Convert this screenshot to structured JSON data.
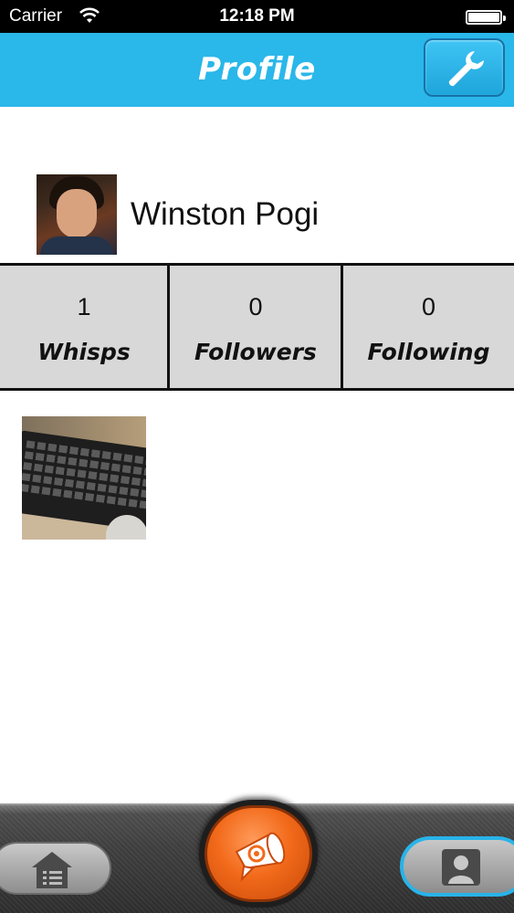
{
  "status_bar": {
    "carrier": "Carrier",
    "time": "12:18 PM",
    "battery_level": 1.0
  },
  "nav_bar": {
    "title": "Profile",
    "settings_icon": "wrench-icon",
    "color": "#2ab7ea"
  },
  "profile": {
    "name": "Winston Pogi"
  },
  "stats": [
    {
      "count": "1",
      "label": "Whisps"
    },
    {
      "count": "0",
      "label": "Followers"
    },
    {
      "count": "0",
      "label": "Following"
    }
  ],
  "tab_bar": {
    "tabs": [
      {
        "icon": "home-icon",
        "selected": false
      },
      {
        "icon": "megaphone-icon",
        "selected": false
      },
      {
        "icon": "profile-icon",
        "selected": true
      }
    ],
    "accent": "#f26a1a",
    "selected_border": "#29b3e8"
  }
}
